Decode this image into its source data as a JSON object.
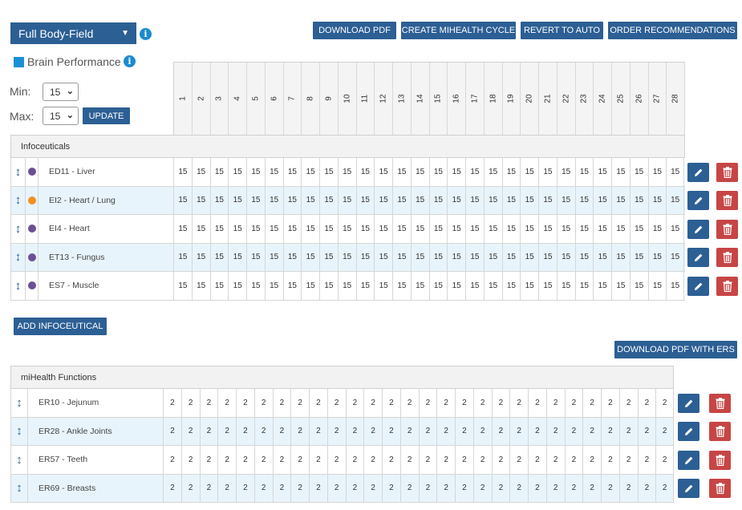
{
  "profile": {
    "selected": "Full Body-Field"
  },
  "toolbar": {
    "download_pdf": "DOWNLOAD PDF",
    "create_cycle": "CREATE MIHEALTH CYCLE",
    "revert": "REVERT TO AUTO",
    "order": "ORDER RECOMMENDATIONS"
  },
  "brain": {
    "label": "Brain Performance"
  },
  "range": {
    "min_label": "Min:",
    "max_label": "Max:",
    "min_value": "15",
    "max_value": "15",
    "update": "UPDATE"
  },
  "days": [
    "1",
    "2",
    "3",
    "4",
    "5",
    "6",
    "7",
    "8",
    "9",
    "10",
    "11",
    "12",
    "13",
    "14",
    "15",
    "16",
    "17",
    "18",
    "19",
    "20",
    "21",
    "22",
    "23",
    "24",
    "25",
    "26",
    "27",
    "28"
  ],
  "infoceuticals": {
    "title": "Infoceuticals",
    "rows": [
      {
        "name": "ED11 - Liver",
        "dot": "#6b4f94",
        "value": "15"
      },
      {
        "name": "EI2 - Heart / Lung",
        "dot": "#f0921e",
        "value": "15"
      },
      {
        "name": "EI4 - Heart",
        "dot": "#6b4f94",
        "value": "15"
      },
      {
        "name": "ET13 - Fungus",
        "dot": "#6b4f94",
        "value": "15"
      },
      {
        "name": "ES7 - Muscle",
        "dot": "#6b4f94",
        "value": "15"
      }
    ],
    "add_button": "ADD INFOCEUTICAL"
  },
  "ers": {
    "download": "DOWNLOAD PDF WITH ERS"
  },
  "mihealth": {
    "title": "miHealth Functions",
    "rows": [
      {
        "name": "ER10 - Jejunum",
        "value": "2"
      },
      {
        "name": "ER28 - Ankle Joints",
        "value": "2"
      },
      {
        "name": "ER57 - Teeth",
        "value": "2"
      },
      {
        "name": "ER69 - Breasts",
        "value": "2"
      }
    ]
  },
  "colors": {
    "accent": "#2c5f94",
    "danger": "#c74545",
    "info": "#1a8bd0",
    "alt_row": "#e8f4fb"
  },
  "icons": {
    "drag": "updown-arrow-icon",
    "edit": "pencil-icon",
    "delete": "trash-icon",
    "info": "info-icon"
  }
}
